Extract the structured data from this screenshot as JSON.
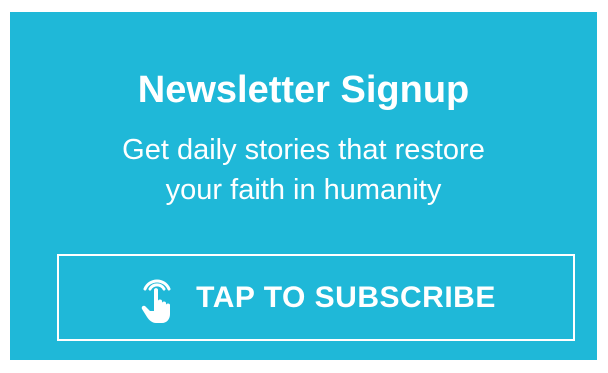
{
  "newsletter": {
    "title": "Newsletter Signup",
    "subtitle_line1": "Get daily stories that restore",
    "subtitle_line2": "your faith in humanity",
    "button_label": "TAP TO SUBSCRIBE",
    "button_icon": "tap-hand-icon",
    "colors": {
      "background": "#1fb8d8",
      "text": "#ffffff",
      "page": "#ffffff"
    }
  }
}
